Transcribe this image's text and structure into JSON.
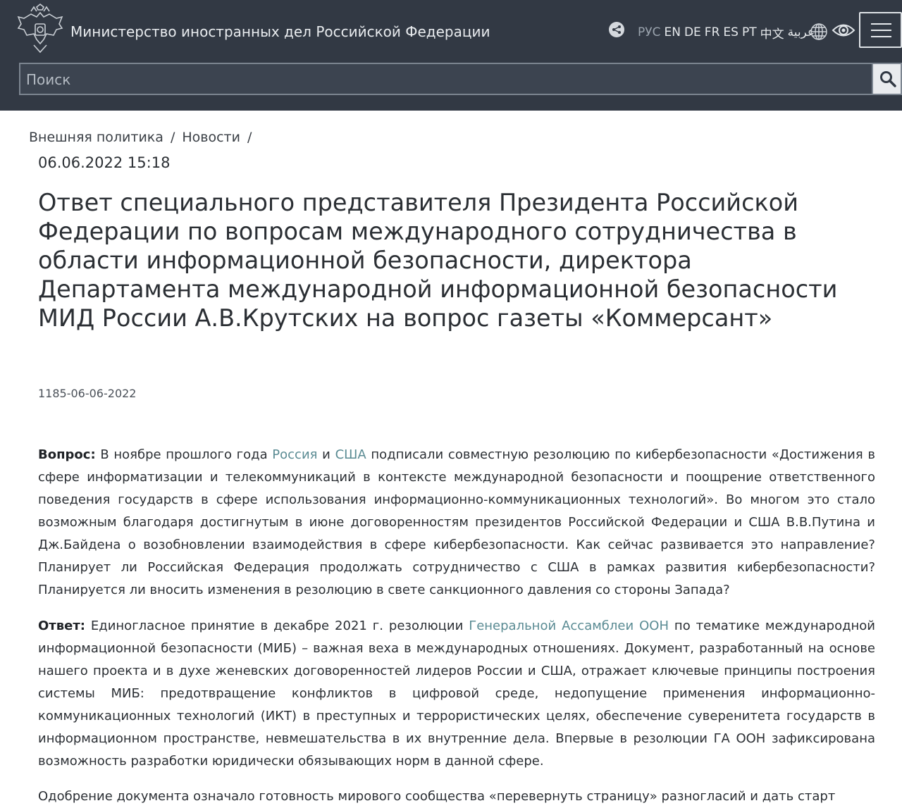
{
  "header": {
    "site_title": "Министерство иностранных дел Российской Федерации",
    "languages": [
      "РУС",
      "EN",
      "DE",
      "FR",
      "ES",
      "PT",
      "中文",
      "عربية"
    ],
    "current_language": "РУС",
    "icons": [
      "emblem",
      "share-icon",
      "globe-icon",
      "eye-icon",
      "menu-icon"
    ],
    "background_color": "#323944"
  },
  "search": {
    "placeholder": "Поиск"
  },
  "breadcrumb": {
    "items": [
      "Внешняя политика",
      "Новости"
    ],
    "separator": "/"
  },
  "article": {
    "date": "06.06.2022 15:18",
    "title": "Ответ специального представителя Президента Российской Федерации по вопросам международного сотрудничества в области информационной безопасности, директора Департамента международной информационной безопасности МИД России А.В.Крутских на вопрос газеты «Коммерсант»",
    "doc_number": "1185-06-06-2022",
    "link_color": "#5a8b93",
    "question": {
      "label": "Вопрос:",
      "t1": " В ноябре прошлого года ",
      "link1": "Россия",
      "t2": " и ",
      "link2": "США",
      "t3": " подписали совместную резолюцию по кибербезопасности «Достижения в сфере информатизации и телекоммуникаций в контексте международной безопасности и поощрение ответственного поведения государств в сфере использования информационно-коммуникационных технологий». Во многом это стало возможным благодаря достигнутым в июне договоренностям президентов Российской Федерации и США В.В.Путина и Дж.Байдена о возобновлении взаимодействия в сфере кибербезопасности. Как сейчас развивается это направление? Планирует ли Российская Федерация продолжать сотрудничество с США в рамках развития кибербезопасности? Планируется ли вносить изменения в резолюцию в свете санкционного давления со стороны Запада?"
    },
    "answer": {
      "label": "Ответ:",
      "t1": " Единогласное принятие в декабре 2021 г. резолюции ",
      "link1": "Генеральной Ассамблеи ООН",
      "t2": " по тематике международной информационной безопасности (МИБ) – важная веха в международных отношениях. Документ, разработанный на основе нашего проекта и в духе женевских договоренностей лидеров России и США, отражает ключевые принципы построения системы МИБ: предотвращение конфликтов в цифровой среде, недопущение применения информационно-коммуникационных технологий (ИКТ) в преступных и террористических целях, обеспечение суверенитета государств в информационном пространстве, невмешательства в их внутренние дела. Впервые в резолюции ГА ООН зафиксирована возможность разработки юридически обязывающих норм в данной сфере."
    },
    "para3": "Одобрение документа означало готовность мирового сообщества «перевернуть страницу» разногласий и дать старт"
  }
}
